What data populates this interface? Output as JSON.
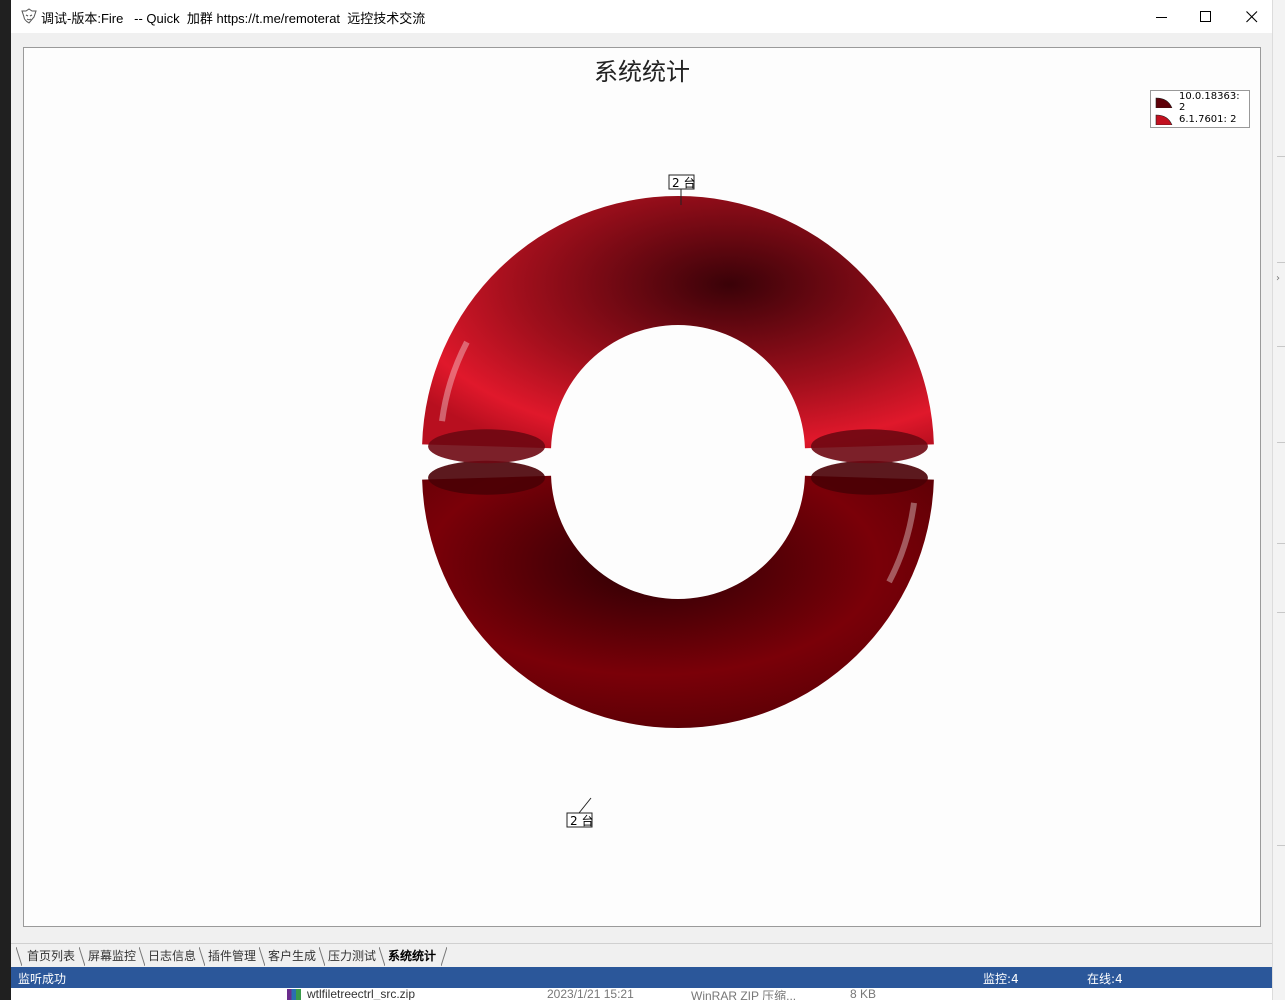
{
  "window": {
    "title": "调试-版本:Fire   -- Quick  加群 https://t.me/remoterat  远控技术交流"
  },
  "chart_data": {
    "type": "pie",
    "title": "系统统计",
    "categories": [
      "10.0.18363",
      "6.1.7601"
    ],
    "values": [
      2,
      2
    ],
    "value_unit": "台",
    "data_labels": [
      "2 台",
      "2 台"
    ],
    "legend": [
      "10.0.18363: 2",
      "6.1.7601: 2"
    ],
    "legend_position": "top-right",
    "colors": [
      "#5e0008",
      "#c2101f"
    ],
    "style": "3d-donut-exploded"
  },
  "tabs": [
    {
      "label": "首页列表",
      "active": false
    },
    {
      "label": "屏幕监控",
      "active": false
    },
    {
      "label": "日志信息",
      "active": false
    },
    {
      "label": "插件管理",
      "active": false
    },
    {
      "label": "客户生成",
      "active": false
    },
    {
      "label": "压力测试",
      "active": false
    },
    {
      "label": "系统统计",
      "active": true
    }
  ],
  "status": {
    "left": "监听成功",
    "monitor": "监控:4",
    "online": "在线:4"
  },
  "background_file": {
    "name": "wtlfiletreectrl_src.zip",
    "date": "2023/1/21 15:21",
    "type": "WinRAR ZIP 压缩...",
    "size": "8 KB"
  },
  "icons": {
    "app": "fire-app-icon",
    "minimize": "minimize-icon",
    "maximize": "maximize-icon",
    "close": "close-icon"
  }
}
